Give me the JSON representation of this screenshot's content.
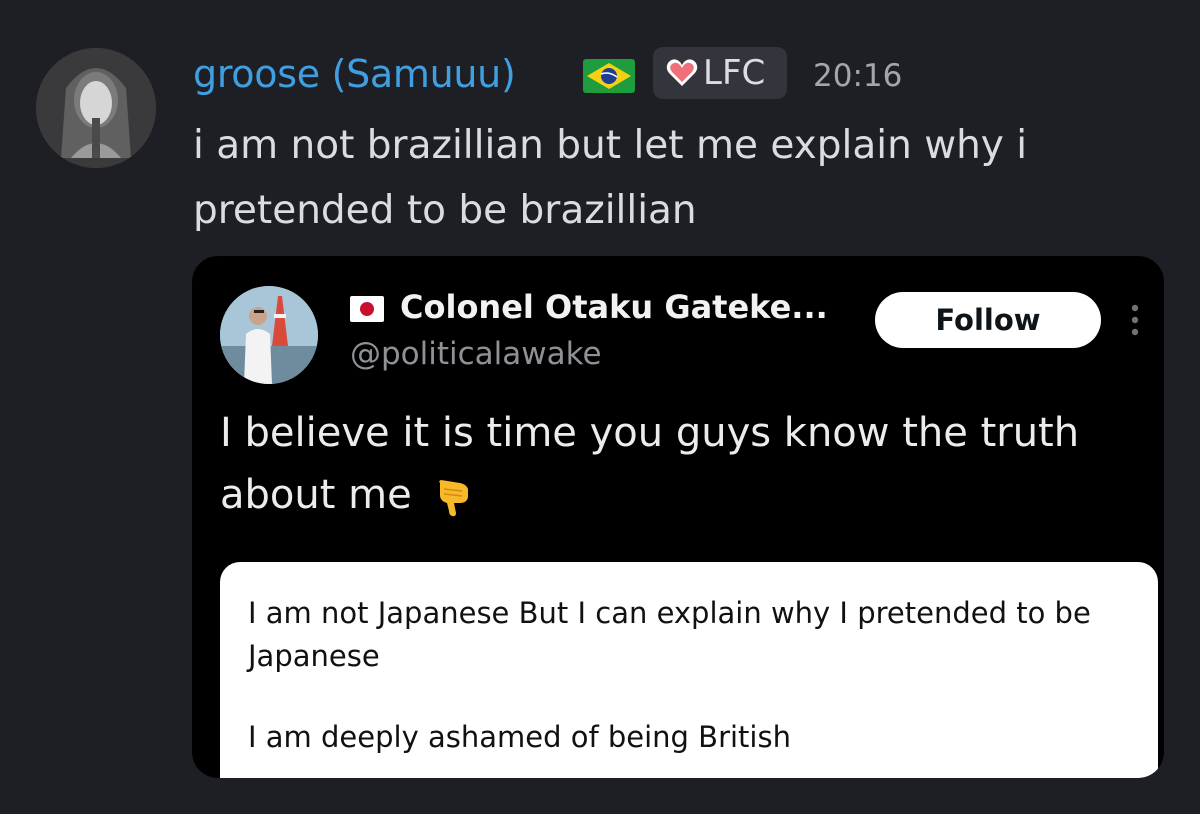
{
  "message": {
    "username": "groose (Samuuu)",
    "flag_icon": "brazil-flag-icon",
    "role_tag": {
      "icon": "heart-icon",
      "label": "LFC",
      "heart_color": "#f0707a"
    },
    "timestamp": "20:16",
    "text": "i am not brazillian but let me explain why i pretended to be brazillian",
    "username_color": "#3f9fe0"
  },
  "embed": {
    "author_name": "Colonel Otaku Gateke...",
    "author_flag_icon": "japan-flag-icon",
    "handle": "@politicalawake",
    "follow_label": "Follow",
    "more_icon": "vertical-ellipsis-icon",
    "post_text": "I believe it is time you guys know the truth about me",
    "emoji": "pointing-down-hand-icon",
    "quote": {
      "line1": "I am not Japanese But I can explain why I pretended to be Japanese",
      "line2": "I am deeply ashamed of being British"
    }
  }
}
